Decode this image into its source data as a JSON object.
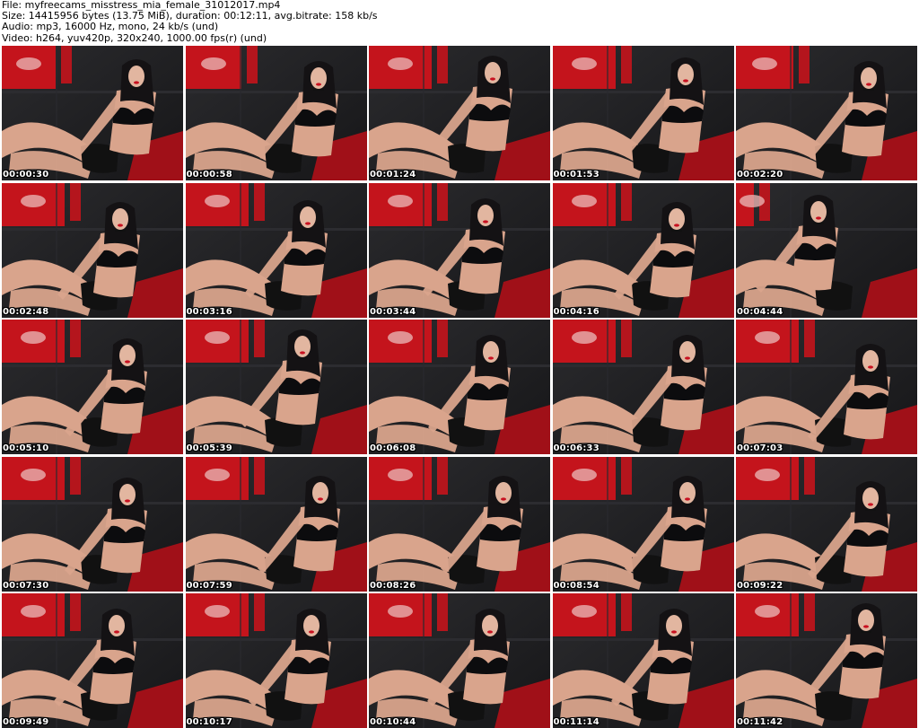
{
  "header": {
    "file_line": "File: myfreecams_misstress_mia_female_31012017.mp4",
    "size_line": "Size: 14415956 bytes (13.75 MiB), duration: 00:12:11, avg.bitrate: 158 kb/s",
    "audio_line": "Audio: mp3, 16000 Hz, mono, 24 kb/s (und)",
    "video_line": "Video: h264, yuv420p, 320x240, 1000.00 fps(r) (und)"
  },
  "thumbnails": [
    {
      "timestamp": "00:00:30"
    },
    {
      "timestamp": "00:00:58"
    },
    {
      "timestamp": "00:01:24"
    },
    {
      "timestamp": "00:01:53"
    },
    {
      "timestamp": "00:02:20"
    },
    {
      "timestamp": "00:02:48"
    },
    {
      "timestamp": "00:03:16"
    },
    {
      "timestamp": "00:03:44"
    },
    {
      "timestamp": "00:04:16"
    },
    {
      "timestamp": "00:04:44"
    },
    {
      "timestamp": "00:05:10"
    },
    {
      "timestamp": "00:05:39"
    },
    {
      "timestamp": "00:06:08"
    },
    {
      "timestamp": "00:06:33"
    },
    {
      "timestamp": "00:07:03"
    },
    {
      "timestamp": "00:07:30"
    },
    {
      "timestamp": "00:07:59"
    },
    {
      "timestamp": "00:08:26"
    },
    {
      "timestamp": "00:08:54"
    },
    {
      "timestamp": "00:09:22"
    },
    {
      "timestamp": "00:09:49"
    },
    {
      "timestamp": "00:10:17"
    },
    {
      "timestamp": "00:10:44"
    },
    {
      "timestamp": "00:11:14"
    },
    {
      "timestamp": "00:11:42"
    }
  ],
  "colors": {
    "background": "#ffffff",
    "sofa": "#1c1c1e",
    "red_panel": "#c4141c",
    "skin": "#d9a48c",
    "hair": "#141214",
    "timestamp_text": "#ffffff"
  }
}
